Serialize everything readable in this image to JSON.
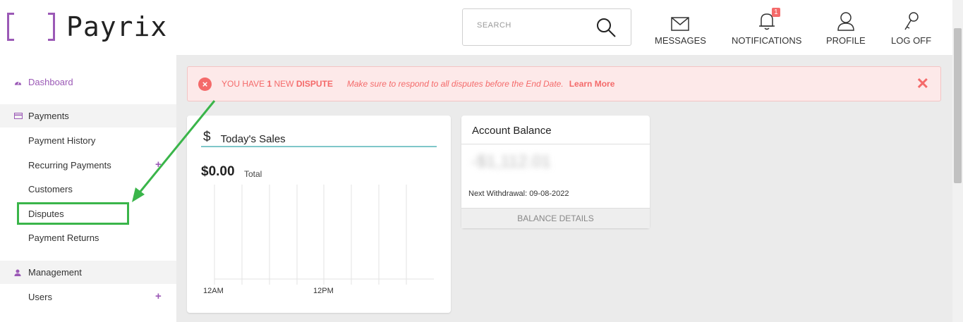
{
  "brand": {
    "name": "Payrix",
    "color": "#9b59b6"
  },
  "search": {
    "placeholder": "SEARCH",
    "icon": "search-icon"
  },
  "nav": {
    "messages": "MESSAGES",
    "notifications": "NOTIFICATIONS",
    "notifications_badge": "1",
    "profile": "PROFILE",
    "logoff": "LOG OFF"
  },
  "sidebar": {
    "dashboard": "Dashboard",
    "payments_section": "Payments",
    "payments_items": [
      "Payment History",
      "Recurring Payments",
      "Customers",
      "Disputes",
      "Payment Returns"
    ],
    "management_section": "Management",
    "management_items": [
      "Users"
    ],
    "plus": "+"
  },
  "alert": {
    "prefix": "YOU HAVE ",
    "count": "1",
    "middle": " NEW ",
    "keyword": "DISPUTE",
    "note": "Make sure to respond to all disputes before the End Date.",
    "link": "Learn More",
    "close": "✕",
    "color": "#f46a6a"
  },
  "sales_card": {
    "title": "Today's Sales",
    "icon": "$",
    "amount": "$0.00",
    "amount_label": "Total",
    "tick_labels": [
      "12AM",
      "12PM"
    ]
  },
  "balance_card": {
    "title": "Account Balance",
    "amount": "-$1,112.01",
    "next_withdrawal": "Next Withdrawal: 09-08-2022",
    "details_button": "BALANCE DETAILS"
  }
}
